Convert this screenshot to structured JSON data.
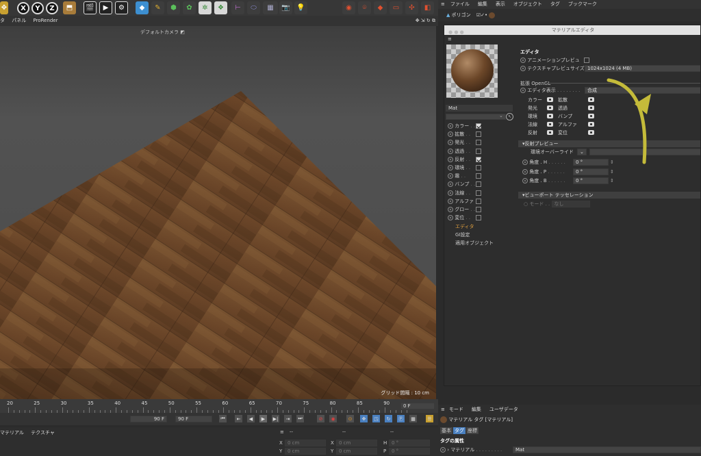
{
  "top_menu": {
    "items": [
      "ファイル",
      "編集",
      "表示",
      "オブジェクト",
      "タグ",
      "ブックマーク"
    ]
  },
  "viewport": {
    "menu": [
      "タ",
      "パネル",
      "ProRender"
    ],
    "camera": "デフォルトカメラ",
    "grid": "グリッド間隔 : 10 cm"
  },
  "obj_row": {
    "label": "ポリゴン"
  },
  "material_editor": {
    "title": "マテリアルエディタ",
    "material_name": "Mat",
    "channels": [
      {
        "label": "カラー",
        "checked": true
      },
      {
        "label": "拡散",
        "checked": false
      },
      {
        "label": "発光",
        "checked": false
      },
      {
        "label": "透過",
        "checked": false
      },
      {
        "label": "反射",
        "checked": true
      },
      {
        "label": "環境",
        "checked": false
      },
      {
        "label": "霧",
        "checked": false
      },
      {
        "label": "バンプ",
        "checked": false
      },
      {
        "label": "法線",
        "checked": false
      },
      {
        "label": "アルファ",
        "checked": false
      },
      {
        "label": "グロー",
        "checked": false
      },
      {
        "label": "変位",
        "checked": false
      }
    ],
    "extra_channels": [
      "エディタ",
      "GI設定",
      "適用オブジェクト"
    ],
    "section_title": "エディタ",
    "anim_preview_label": "アニメーションプレビュ",
    "tex_preview_label": "テクスチャプレビュサイズ",
    "tex_preview_value": "1024x1024 (4 MB)",
    "opengl_label": "拡張 OpenGL",
    "editor_display_label": "エディタ表示",
    "editor_display_value": "合成",
    "gl_left": [
      "カラー",
      "発光",
      "環境",
      "法線",
      "反射"
    ],
    "gl_right": [
      "拡散",
      "透過",
      "バンプ",
      "アルファ",
      "変位"
    ],
    "reflect_preview": "反射プレビュー",
    "env_override": "環境オーバーライド",
    "angles": [
      {
        "label": "角度 . H",
        "value": "0 °"
      },
      {
        "label": "角度 . P",
        "value": "0 °"
      },
      {
        "label": "角度 . B",
        "value": "0 °"
      }
    ],
    "tess_section": "ビューポート テッセレーション",
    "mode_label": "モード",
    "mode_value": "なし"
  },
  "timeline": {
    "ticks": [
      "20",
      "25",
      "30",
      "35",
      "40",
      "45",
      "50",
      "55",
      "60",
      "65",
      "70",
      "75",
      "80",
      "85",
      "90"
    ],
    "frame_end": "90 F",
    "frame_end2": "90 F",
    "current": "0 F"
  },
  "bottom_left": {
    "menu": [
      "マテリアル",
      "テクスチャ"
    ]
  },
  "coords": {
    "header": [
      "--",
      "--",
      "--"
    ],
    "rows": [
      {
        "axis": "X",
        "val": "0 cm",
        "axis2": "X",
        "val2": "0 cm",
        "axis3": "H",
        "val3": "0 °"
      },
      {
        "axis": "Y",
        "val": "0 cm",
        "axis2": "Y",
        "val2": "0 cm",
        "axis3": "P",
        "val3": "0 °"
      }
    ]
  },
  "attr": {
    "menu": [
      "モード",
      "編集",
      "ユーザデータ"
    ],
    "title": "マテリアル タグ [マテリアル]",
    "tabs": [
      "基本",
      "タグ",
      "座標"
    ],
    "section": "タグの属性",
    "material_label": "マテリアル",
    "material_value": "Mat"
  }
}
